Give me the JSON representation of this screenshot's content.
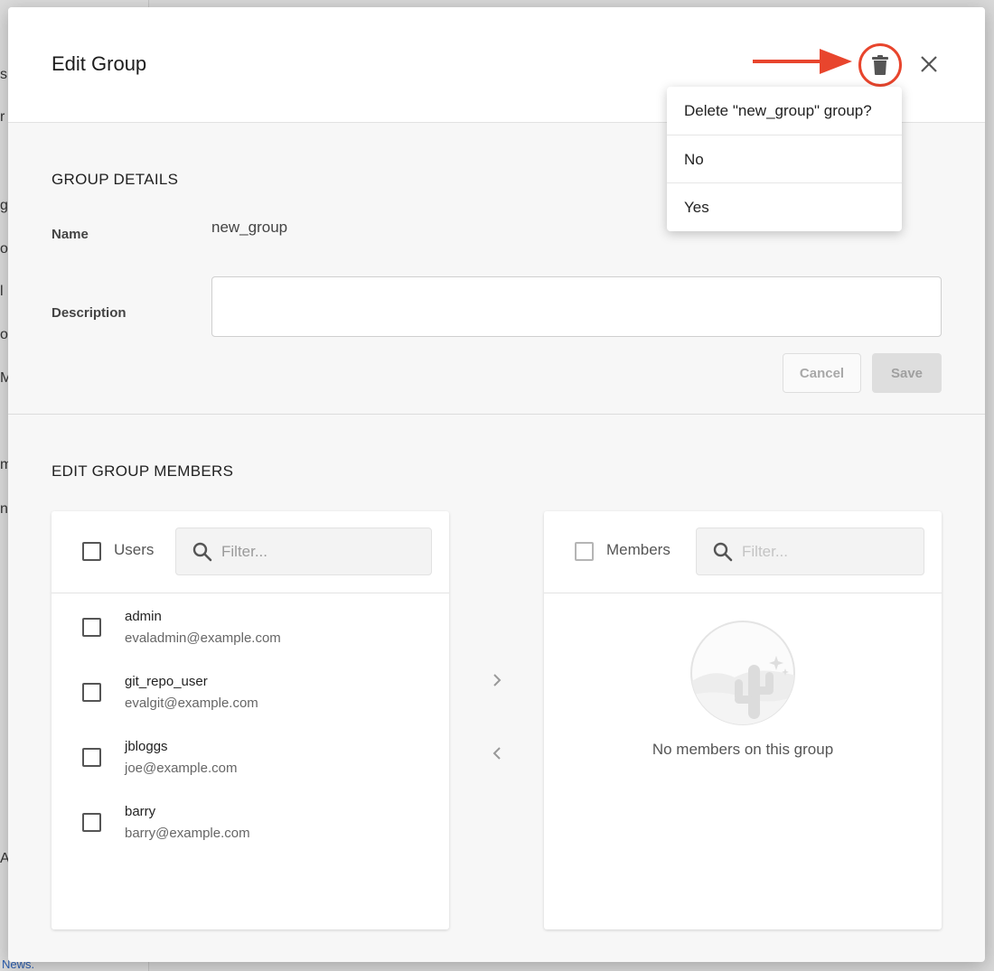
{
  "background": {
    "fragments": [
      "s",
      "r",
      "g",
      "o",
      "l",
      "o",
      "M",
      "m",
      "n",
      "A"
    ],
    "link_text": "News."
  },
  "dialog": {
    "title": "Edit Group",
    "delete_icon": "trash-icon",
    "close_icon": "close-icon",
    "annotation_arrow_color": "#e8452d"
  },
  "delete_confirm": {
    "question": "Delete \"new_group\" group?",
    "no_label": "No",
    "yes_label": "Yes"
  },
  "group_details": {
    "section_title": "GROUP DETAILS",
    "name_label": "Name",
    "name_value": "new_group",
    "description_label": "Description",
    "description_value": "",
    "cancel_label": "Cancel",
    "save_label": "Save"
  },
  "members_editor": {
    "section_title": "EDIT GROUP MEMBERS",
    "users_panel": {
      "header_label": "Users",
      "filter_placeholder": "Filter...",
      "users": [
        {
          "name": "admin",
          "email": "evaladmin@example.com"
        },
        {
          "name": "git_repo_user",
          "email": "evalgit@example.com"
        },
        {
          "name": "jbloggs",
          "email": "joe@example.com"
        },
        {
          "name": "barry",
          "email": "barry@example.com"
        }
      ]
    },
    "members_panel": {
      "header_label": "Members",
      "filter_placeholder": "Filter...",
      "empty_text": "No members on this group"
    },
    "add_icon": "chevron-right-icon",
    "remove_icon": "chevron-left-icon"
  }
}
